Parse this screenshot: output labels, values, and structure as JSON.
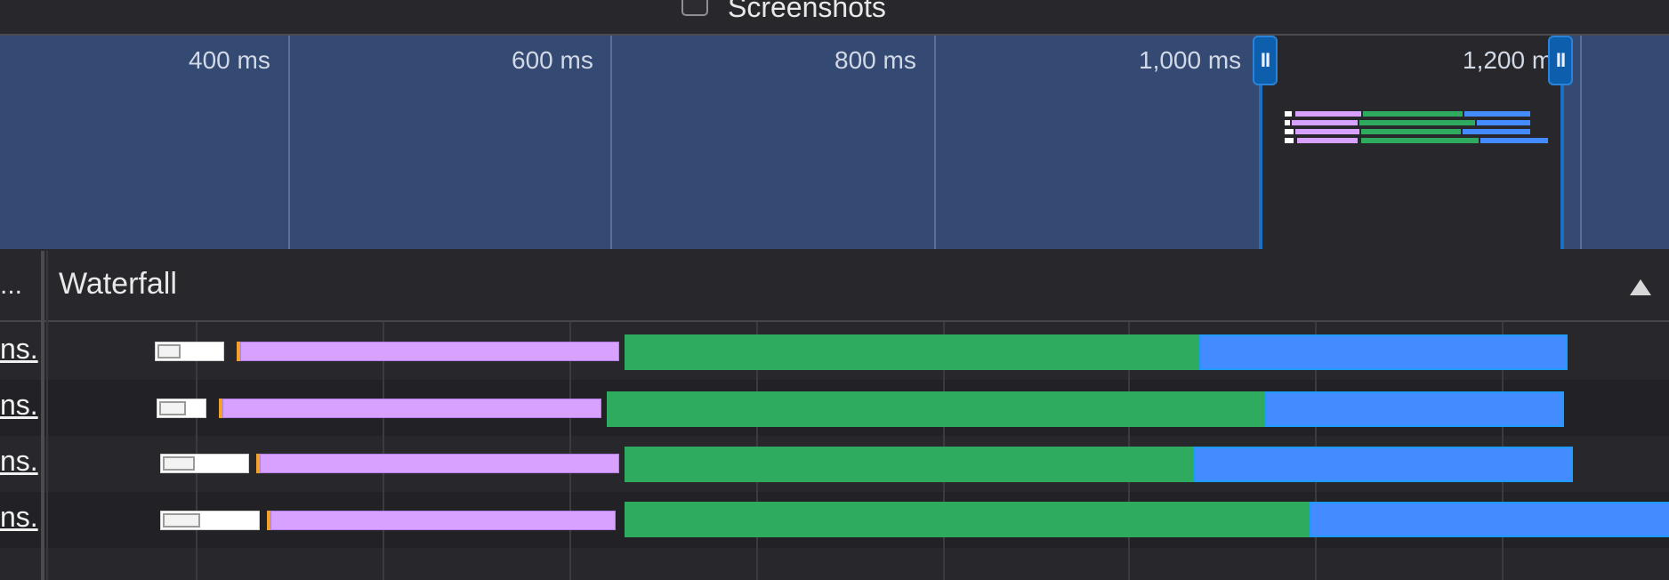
{
  "top_bar": {
    "screenshots_label": "Screenshots",
    "screenshots_checked": false
  },
  "overview": {
    "ticks": [
      "400 ms",
      "600 ms",
      "800 ms",
      "1,000 ms",
      "1,200 ms"
    ],
    "selection_handle_glyph": "II"
  },
  "table": {
    "name_header_truncated": "...",
    "waterfall_header": "Waterfall",
    "sort_direction": "ascending",
    "rows": [
      {
        "name_fragment": "ns."
      },
      {
        "name_fragment": "ns."
      },
      {
        "name_fragment": "ns."
      },
      {
        "name_fragment": "ns."
      }
    ]
  },
  "colors": {
    "overview_bg": "#344a72",
    "selection_border": "#1c6fc1",
    "connect": "#d9a1ff",
    "send": "#2eab5e",
    "receive": "#438bff",
    "dns": "#f0a22a"
  },
  "icons": {
    "sort": "triangle-up-icon",
    "handle": "pause-handle-icon"
  }
}
